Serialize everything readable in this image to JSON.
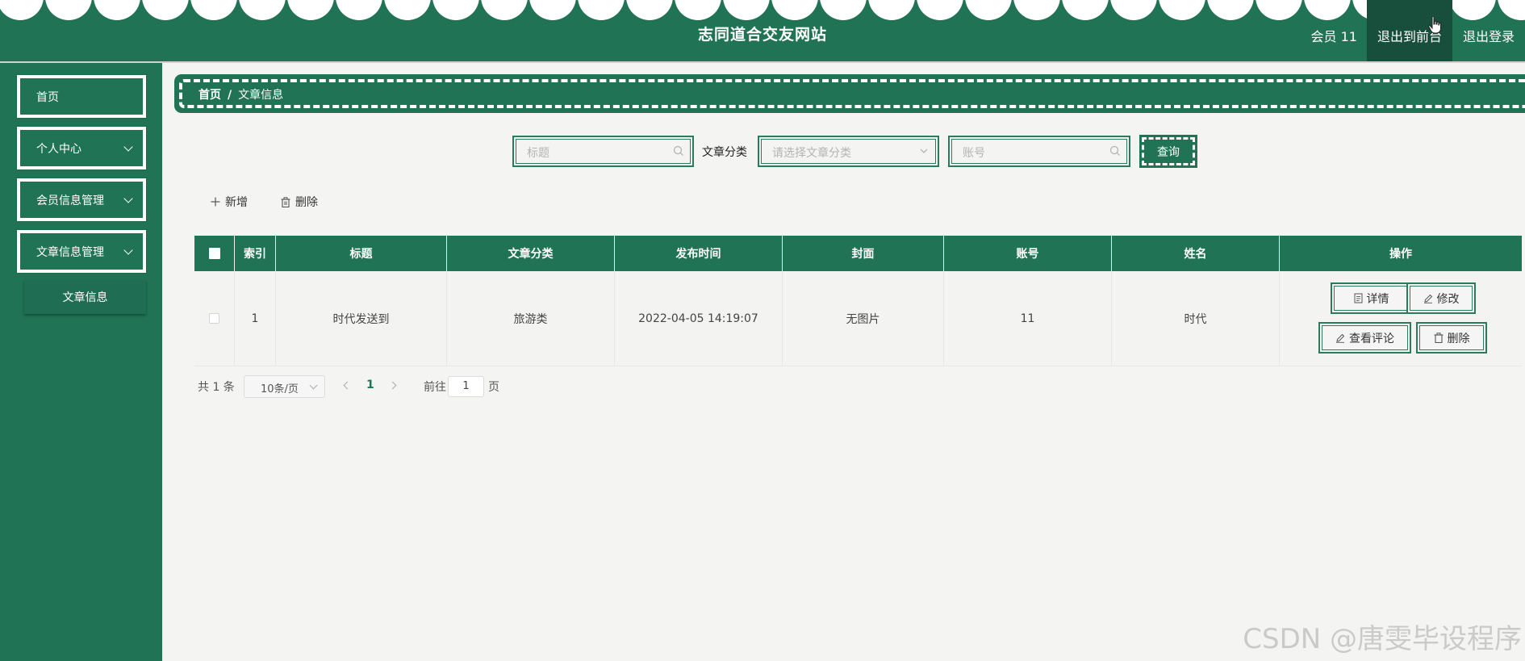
{
  "header": {
    "title": "志同道合交友网站",
    "user_label": "会员 11",
    "back_to_front": "退出到前台",
    "logout": "退出登录"
  },
  "sidebar": {
    "items": [
      {
        "label": "首页",
        "has_children": false
      },
      {
        "label": "个人中心",
        "has_children": true
      },
      {
        "label": "会员信息管理",
        "has_children": true
      },
      {
        "label": "文章信息管理",
        "has_children": true
      }
    ],
    "submenu_active": "文章信息"
  },
  "breadcrumb": {
    "home": "首页",
    "separator": "/",
    "current": "文章信息"
  },
  "search": {
    "title_placeholder": "标题",
    "category_label": "文章分类",
    "category_placeholder": "请选择文章分类",
    "account_placeholder": "账号",
    "query_button": "查询"
  },
  "toolbar": {
    "add_label": "新增",
    "delete_label": "删除"
  },
  "table": {
    "columns": [
      "索引",
      "标题",
      "文章分类",
      "发布时间",
      "封面",
      "账号",
      "姓名",
      "操作"
    ],
    "rows": [
      {
        "index": "1",
        "title": "时代发送到",
        "category": "旅游类",
        "publish_time": "2022-04-05 14:19:07",
        "cover": "无图片",
        "account": "11",
        "name": "时代"
      }
    ],
    "row_actions": {
      "detail": "详情",
      "edit": "修改",
      "view_comments": "查看评论",
      "delete": "删除"
    }
  },
  "pagination": {
    "total_text": "共 1 条",
    "page_size": "10条/页",
    "current_page": "1",
    "goto_label": "前往",
    "goto_value": "1",
    "goto_unit": "页"
  },
  "watermark": "CSDN @唐雯毕设程序",
  "colors": {
    "primary": "#217356",
    "background": "#f4f4f3"
  }
}
